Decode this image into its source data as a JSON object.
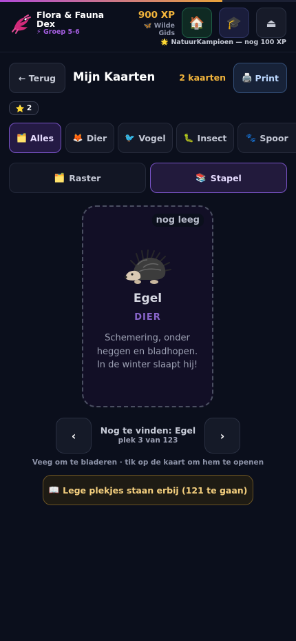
{
  "progress": {
    "fraction": 0.75
  },
  "header": {
    "app_title": "Flora & Fauna Dex",
    "group_icon": "⚡",
    "group_label": "Groep 5-6",
    "xp": "900 XP",
    "rank_icon": "🦋",
    "rank": "Wilde Gids",
    "home_icon": "🏠",
    "learn_icon": "🎓",
    "logout_icon": "⏏",
    "next_level_icon": "🌟",
    "next_level": "NatuurKampioen — nog 100 XP"
  },
  "titlebar": {
    "back_label": "← Terug",
    "title": "Mijn Kaarten",
    "count": "2 kaarten",
    "print_icon": "🖨️",
    "print_label": "Print",
    "star_icon": "⭐",
    "star_count": "2"
  },
  "filters": [
    {
      "icon": "🗂️",
      "label": "Alles",
      "active": true
    },
    {
      "icon": "🦊",
      "label": "Dier",
      "active": false
    },
    {
      "icon": "🐦",
      "label": "Vogel",
      "active": false
    },
    {
      "icon": "🐛",
      "label": "Insect",
      "active": false
    },
    {
      "icon": "🐾",
      "label": "Spoor",
      "active": false
    }
  ],
  "view_modes": [
    {
      "icon": "🗂️",
      "label": "Raster",
      "active": false
    },
    {
      "icon": "📚",
      "label": "Stapel",
      "active": true
    }
  ],
  "card": {
    "status": "nog leeg",
    "name": "Egel",
    "type": "DIER",
    "description": "Schemering, onder heggen en bladhopen. In de winter slaapt hij!"
  },
  "navigation": {
    "prev_icon": "‹",
    "next_icon": "›",
    "title": "Nog te vinden: Egel",
    "position": "plek 3 van 123",
    "hint": "Veeg om te bladeren · tik op de kaart om hem te openen"
  },
  "empty_slots": {
    "icon": "📖",
    "label": "Lege plekjes staan erbij (121 te gaan)"
  },
  "colors": {
    "accent": "#7a54c8",
    "xp": "#f1b43c",
    "background": "#0b0f1c"
  }
}
